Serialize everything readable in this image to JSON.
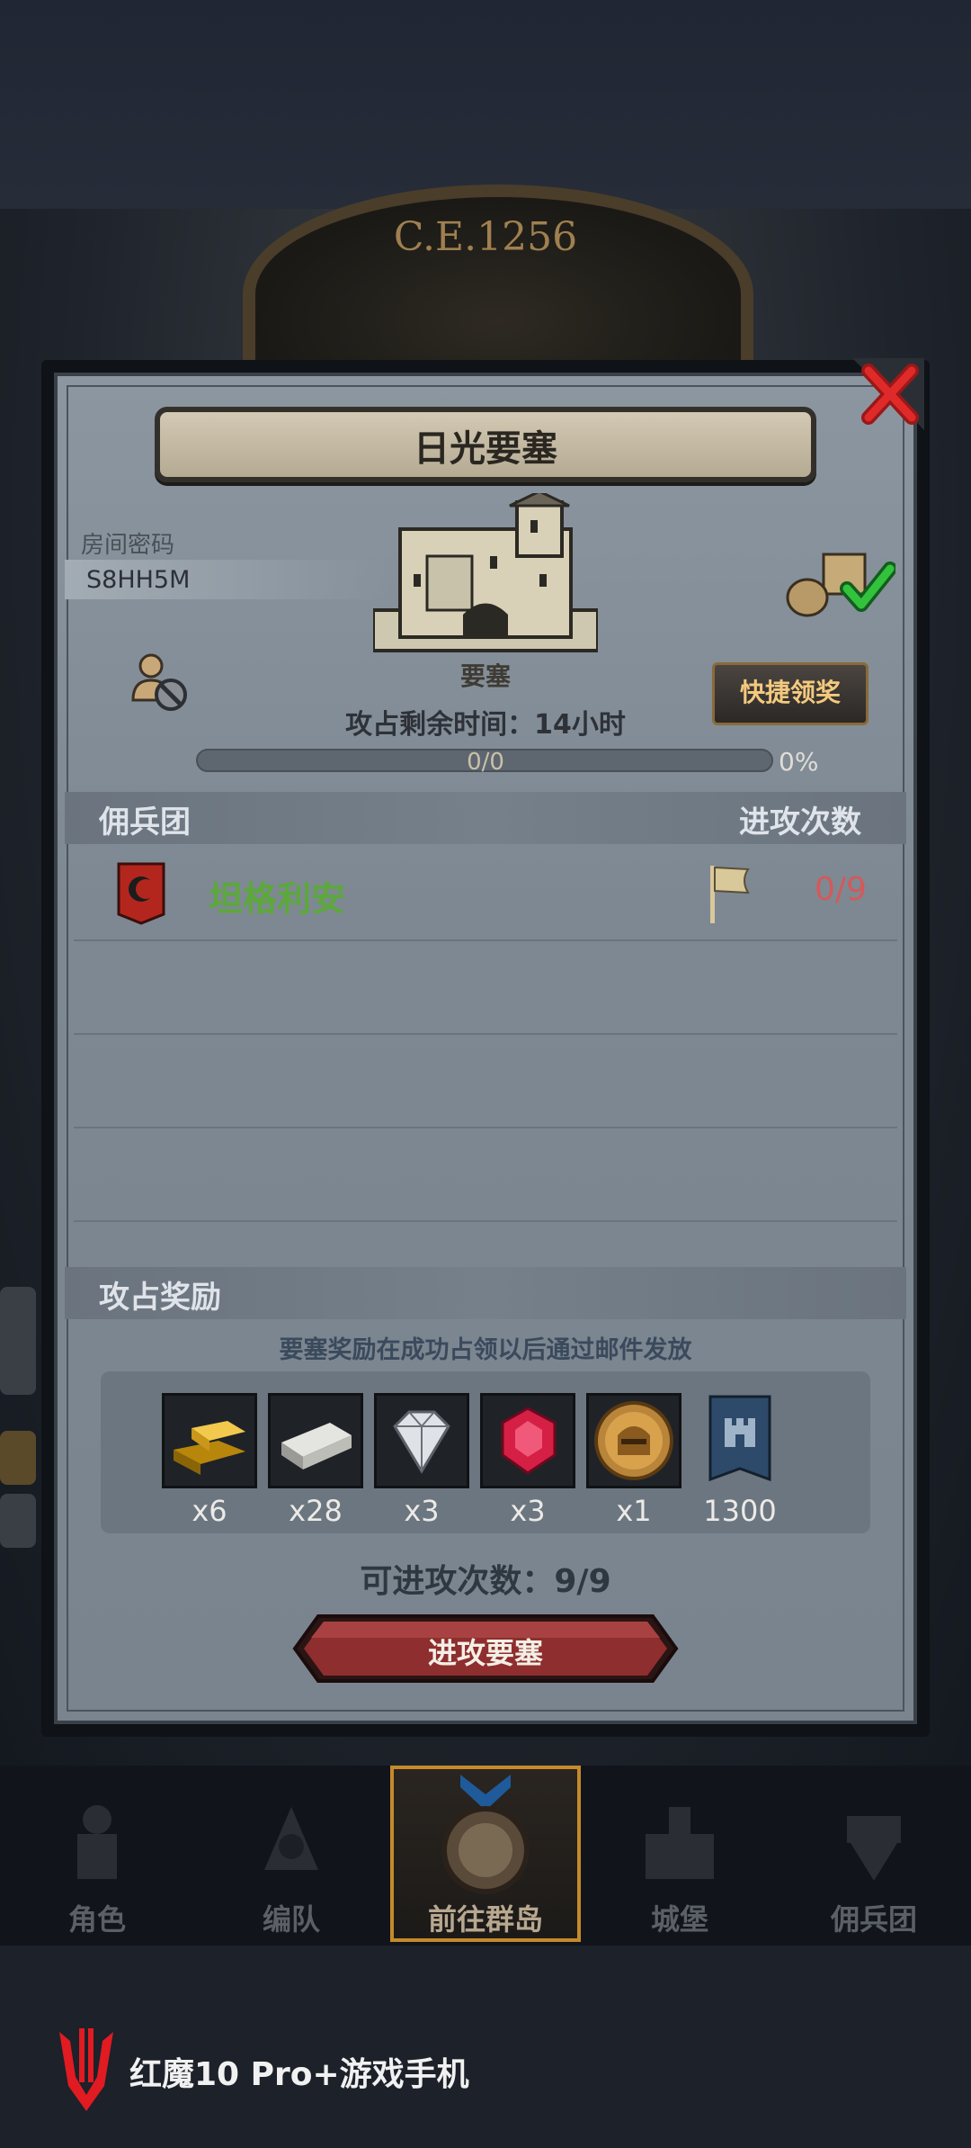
{
  "header": {
    "era": "C.E.1256"
  },
  "dialog": {
    "title": "日光要塞",
    "room_code_label": "房间密码",
    "room_code": "S8HH5M",
    "building_label": "要塞",
    "quick_claim_label": "快捷领奖",
    "time_remaining": "攻占剩余时间：14小时",
    "progress": {
      "count": "0/0",
      "percent": "0%",
      "fraction": 0
    },
    "columns": {
      "mercenary": "佣兵团",
      "attack_count": "进攻次数"
    },
    "mercenaries": [
      {
        "name": "坦格利安",
        "attacks": "0/9"
      }
    ],
    "rewards": {
      "title": "攻占奖励",
      "note": "要塞奖励在成功占领以后通过邮件发放",
      "items": [
        {
          "icon": "gold-bar-icon",
          "qty": "x6"
        },
        {
          "icon": "iron-bar-icon",
          "qty": "x28"
        },
        {
          "icon": "diamond-icon",
          "qty": "x3"
        },
        {
          "icon": "ruby-icon",
          "qty": "x3"
        },
        {
          "icon": "knight-helmet-coin-icon",
          "qty": "x1"
        },
        {
          "icon": "castle-banner-icon",
          "qty": "1300"
        }
      ]
    },
    "attacks_remaining": "可进攻次数：9/9",
    "attack_button": "进攻要塞"
  },
  "bottom_nav": [
    {
      "label": "角色",
      "icon": "knight-icon",
      "selected": false
    },
    {
      "label": "编队",
      "icon": "formation-icon",
      "selected": false
    },
    {
      "label": "前往群岛",
      "icon": "compass-icon",
      "selected": true
    },
    {
      "label": "城堡",
      "icon": "castle-icon",
      "selected": false
    },
    {
      "label": "佣兵团",
      "icon": "mercenary-icon",
      "selected": false
    }
  ],
  "watermark": {
    "text": "红魔10 Pro+游戏手机"
  },
  "colors": {
    "merc_name": "#5ca83b",
    "attack_count": "#d35a5a",
    "quick_claim_text": "#f3c97e",
    "nav_selected_border": "#c58a2a"
  }
}
